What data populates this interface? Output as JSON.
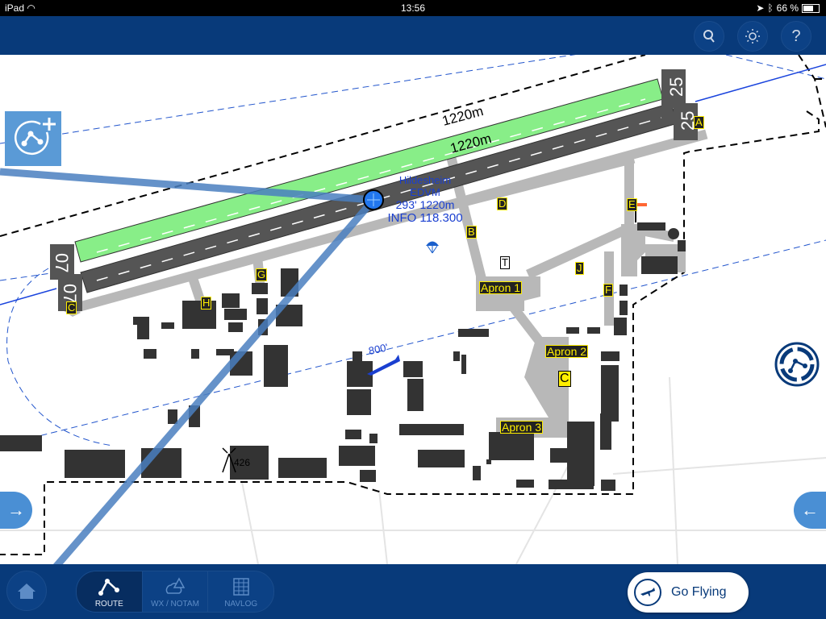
{
  "status_bar": {
    "device": "iPad",
    "time": "13:56",
    "battery": "66 %",
    "battery_level": 0.66
  },
  "header": {
    "buttons": [
      {
        "icon": "search-icon"
      },
      {
        "icon": "brightness-icon"
      },
      {
        "icon": "help-icon",
        "label": "?"
      }
    ]
  },
  "map": {
    "airport": {
      "name": "Hildesheim",
      "icao": "EDVM",
      "elevation_length": "293' 1220m",
      "frequency": "INFO 118.300"
    },
    "runway": {
      "length_label_outer": "1220m",
      "length_label_inner": "1220m",
      "designators": [
        "25",
        "25",
        "07",
        "07"
      ]
    },
    "taxiways": [
      "A",
      "B",
      "C",
      "D",
      "E",
      "F",
      "G",
      "H",
      "J",
      "C"
    ],
    "aprons": [
      "Apron 1",
      "Apron 2",
      "Apron 3"
    ],
    "terminal": "T",
    "traffic_altitude": "800'",
    "obstacle_height": "426"
  },
  "side_buttons": {
    "left_arrow": "→",
    "right_arrow": "←"
  },
  "bottom_bar": {
    "home_icon": "home-icon",
    "tabs": [
      {
        "label": "ROUTE",
        "active": true
      },
      {
        "label": "WX / NOTAM",
        "active": false
      },
      {
        "label": "NAVLOG",
        "active": false
      }
    ],
    "go_flying": "Go Flying"
  },
  "colors": {
    "header_bg": "#083a7a",
    "runway_green": "#88ee88",
    "taxiway_gray": "#b8b8b8",
    "label_yellow": "#ffee00",
    "route_blue": "#4a7fbf"
  }
}
